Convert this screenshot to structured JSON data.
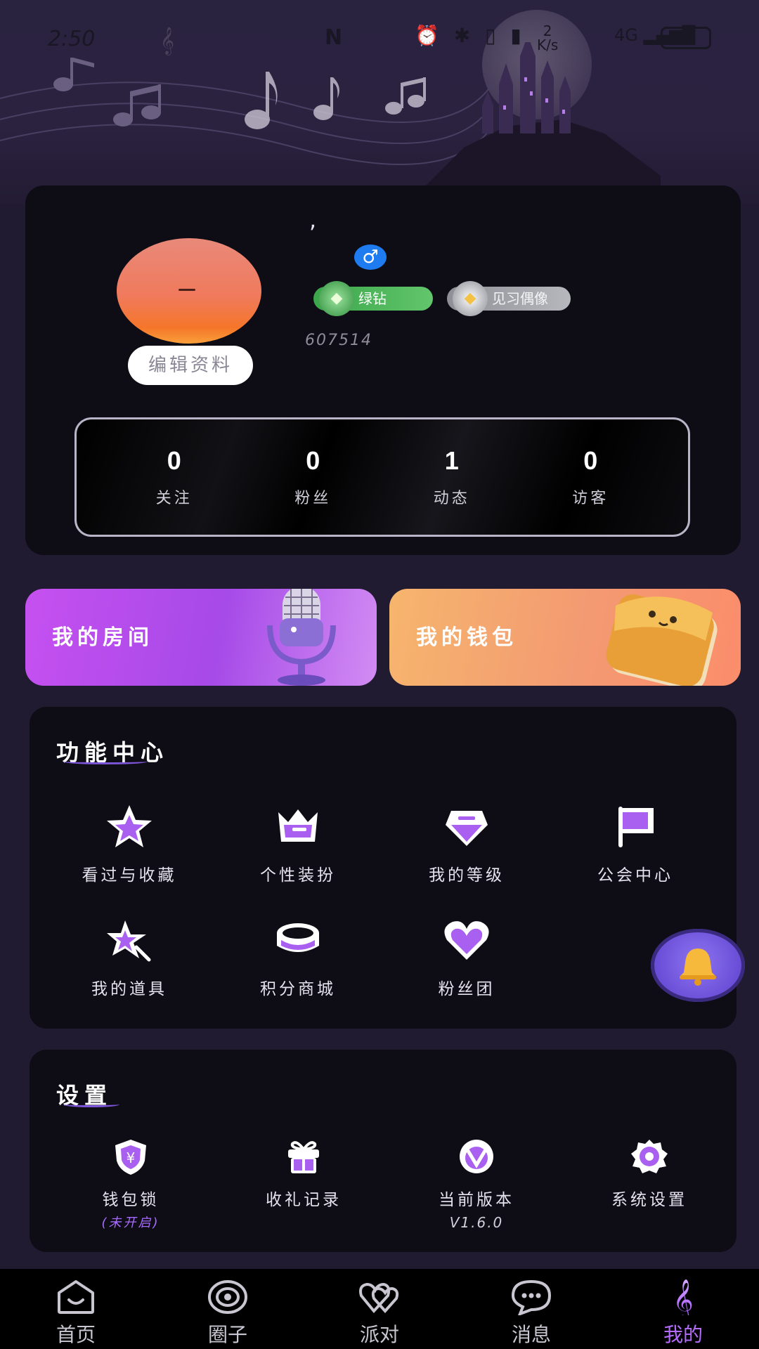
{
  "status_bar": {
    "time": "2:50",
    "net_speed_value": "2",
    "net_speed_unit": "K/s",
    "network": "4G",
    "battery": "87"
  },
  "profile": {
    "nickname": ",",
    "gender_symbol": "♂",
    "badges": [
      "绿钻",
      "见习偶像"
    ],
    "user_id": "607514",
    "edit_label": "编辑资料",
    "stats": [
      {
        "value": "0",
        "label": "关注"
      },
      {
        "value": "0",
        "label": "粉丝"
      },
      {
        "value": "1",
        "label": "动态"
      },
      {
        "value": "0",
        "label": "访客"
      }
    ]
  },
  "promos": {
    "room_label": "我的房间",
    "wallet_label": "我的钱包"
  },
  "function_center": {
    "title": "功能中心",
    "items": [
      {
        "label": "看过与收藏",
        "icon": "star-icon"
      },
      {
        "label": "个性装扮",
        "icon": "crown-icon"
      },
      {
        "label": "我的等级",
        "icon": "gem-icon"
      },
      {
        "label": "公会中心",
        "icon": "flag-icon"
      },
      {
        "label": "我的道具",
        "icon": "magic-star-icon"
      },
      {
        "label": "积分商城",
        "icon": "coin-icon"
      },
      {
        "label": "粉丝团",
        "icon": "heart-icon"
      }
    ]
  },
  "settings": {
    "title": "设置",
    "items": [
      {
        "label": "钱包锁",
        "sub": "(未开启)",
        "icon": "shield-yen-icon"
      },
      {
        "label": "收礼记录",
        "icon": "gift-icon"
      },
      {
        "label": "当前版本",
        "sub": "V1.6.0",
        "icon": "version-icon"
      },
      {
        "label": "系统设置",
        "icon": "gear-icon"
      }
    ]
  },
  "nav": {
    "items": [
      {
        "label": "首页",
        "icon": "home-icon"
      },
      {
        "label": "圈子",
        "icon": "circle-icon"
      },
      {
        "label": "派对",
        "icon": "party-icon"
      },
      {
        "label": "消息",
        "icon": "message-icon"
      },
      {
        "label": "我的",
        "icon": "profile-clef-icon"
      }
    ],
    "active_index": 4
  },
  "colors": {
    "accent": "#b46cff",
    "background": "#211b31",
    "card": "#0e0c14"
  }
}
